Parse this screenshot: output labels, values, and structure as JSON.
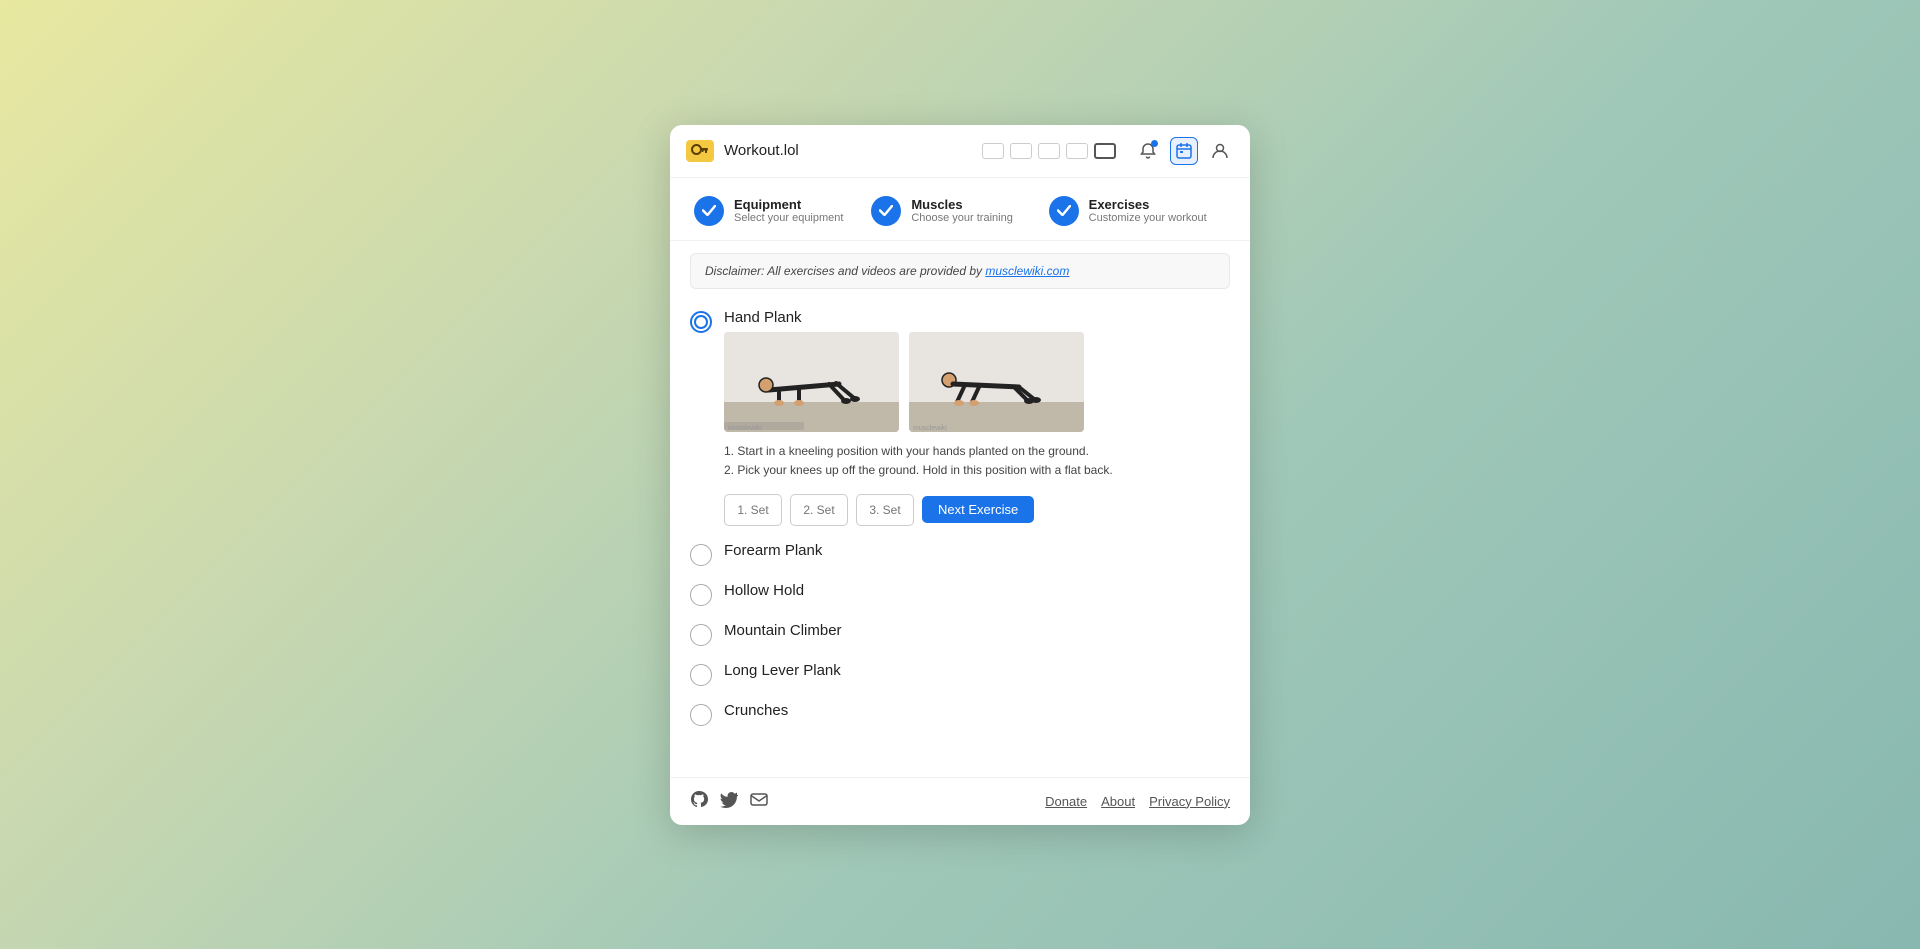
{
  "app": {
    "title": "Workout.lol",
    "logo": "🔑"
  },
  "window_controls": {
    "buttons": [
      "btn1",
      "btn2",
      "btn3",
      "btn4",
      "active"
    ]
  },
  "steps": [
    {
      "id": "equipment",
      "title": "Equipment",
      "subtitle": "Select your equipment",
      "completed": true
    },
    {
      "id": "muscles",
      "title": "Muscles",
      "subtitle": "Choose your training",
      "completed": true
    },
    {
      "id": "exercises",
      "title": "Exercises",
      "subtitle": "Customize your workout",
      "completed": true
    }
  ],
  "disclaimer": {
    "text": "Disclaimer: All exercises and videos are provided by ",
    "link_text": "musclewiki.com",
    "link_href": "https://musclewiki.com"
  },
  "exercises": [
    {
      "id": "hand-plank",
      "name": "Hand Plank",
      "selected": true,
      "expanded": true,
      "instructions": [
        "1. Start in a kneeling position with your hands planted on the ground.",
        "2. Pick your knees up off the ground. Hold in this position with a flat back."
      ],
      "sets": [
        "1. Set",
        "2. Set",
        "3. Set"
      ]
    },
    {
      "id": "forearm-plank",
      "name": "Forearm Plank",
      "selected": false,
      "expanded": false
    },
    {
      "id": "hollow-hold",
      "name": "Hollow Hold",
      "selected": false,
      "expanded": false
    },
    {
      "id": "mountain-climber",
      "name": "Mountain Climber",
      "selected": false,
      "expanded": false
    },
    {
      "id": "long-lever-plank",
      "name": "Long Lever Plank",
      "selected": false,
      "expanded": false
    },
    {
      "id": "crunches",
      "name": "Crunches",
      "selected": false,
      "expanded": false
    }
  ],
  "buttons": {
    "next_exercise": "Next Exercise"
  },
  "footer": {
    "links": [
      "Donate",
      "About",
      "Privacy Policy"
    ],
    "icons": [
      "github",
      "twitter",
      "email"
    ]
  }
}
